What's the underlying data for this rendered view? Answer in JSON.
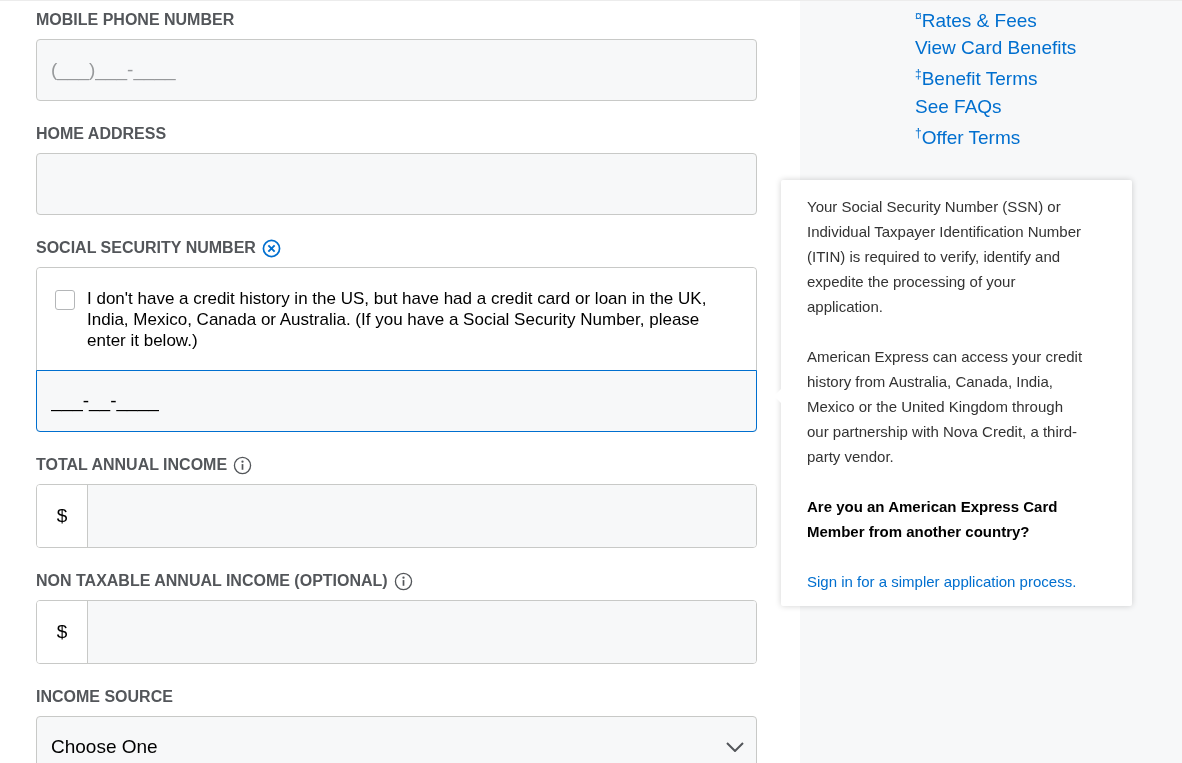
{
  "form": {
    "fields": [
      {
        "kind": "phone",
        "label": "MOBILE PHONE NUMBER",
        "placeholder": "(___)___-____"
      },
      {
        "kind": "text",
        "label": "HOME ADDRESS"
      },
      {
        "kind": "ssn",
        "label": "SOCIAL SECURITY NUMBER",
        "focused": true,
        "checkbox": {
          "label": "I don't have a credit history in the US, but have had a credit card or loan in the UK, India, Mexico, Canada or Australia. (If you have a Social Security Number, please enter it below.)",
          "checked": false
        },
        "value": "___-__-____"
      },
      {
        "kind": "currency",
        "label": "TOTAL ANNUAL INCOME",
        "prefix": "$"
      },
      {
        "kind": "currency",
        "label": "NON TAXABLE ANNUAL INCOME (OPTIONAL)",
        "prefix": "$"
      },
      {
        "kind": "select",
        "label": "INCOME SOURCE",
        "value": "Choose One"
      }
    ]
  },
  "sidebar": {
    "links": [
      "$^{¤}$Rates & Fees",
      "View Card Benefits",
      "$^{‡}$Benefit Terms",
      "See FAQs",
      "$^{†}$Offer Terms"
    ]
  },
  "tooltip": {
    "paragraphs": [
      {
        "kind": "text",
        "text": "Your Social Security Number (SSN) or Individual Taxpayer Identification Number (ITIN) is required to verify, identify and expedite the processing of your application."
      },
      {
        "kind": "text",
        "text": "American Express can access your credit history from Australia, Canada, India, Mexico or the United Kingdom through our partnership with Nova Credit, a third-party vendor."
      },
      {
        "kind": "bold",
        "text": "Are you an American Express Card Member from another country?"
      },
      {
        "kind": "link",
        "text": "Sign in for a simpler application process."
      }
    ]
  }
}
